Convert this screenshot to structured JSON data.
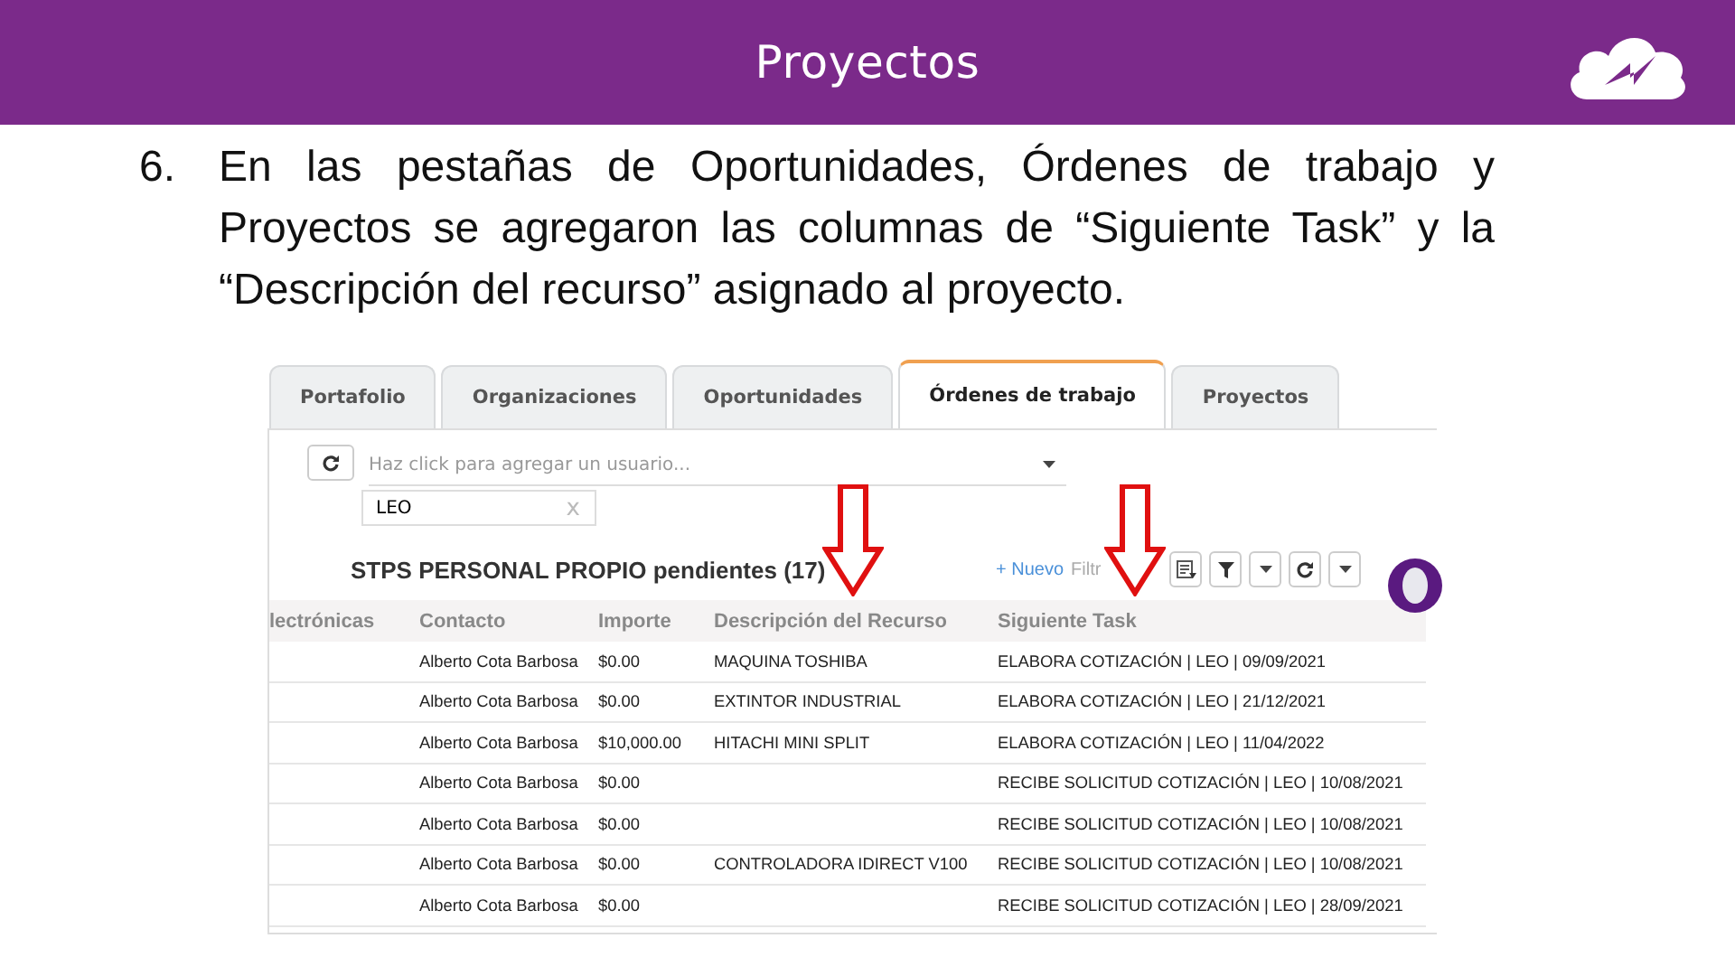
{
  "header": {
    "title": "Proyectos"
  },
  "note": {
    "number": "6.",
    "text": "En las pestañas de Oportunidades, Órdenes de trabajo y Proyectos se agregaron las columnas de “Siguiente Task” y la “Descripción del recurso” asignado al proyecto."
  },
  "app": {
    "tabs": [
      {
        "label": "Portafolio",
        "selected": false
      },
      {
        "label": "Organizaciones",
        "selected": false
      },
      {
        "label": "Oportunidades",
        "selected": false
      },
      {
        "label": "Órdenes de trabajo",
        "selected": true
      },
      {
        "label": "Proyectos",
        "selected": false
      }
    ],
    "user_picker": {
      "placeholder": "Haz click para agregar un usuario...",
      "tags": [
        {
          "label": "LEO",
          "remove": "x"
        }
      ]
    },
    "list_title": "STPS PERSONAL PROPIO pendientes (17)",
    "new_link": "+ Nuevo",
    "filter_link": "Filtr",
    "table": {
      "columns": [
        "lectrónicas",
        "Contacto",
        "Importe",
        "Descripción del Recurso",
        "Siguiente Task"
      ],
      "rows": [
        {
          "contacto": "Alberto Cota Barbosa",
          "importe": "$0.00",
          "descripcion": "MAQUINA TOSHIBA",
          "siguiente": "ELABORA COTIZACIÓN | LEO | 09/09/2021"
        },
        {
          "contacto": "Alberto Cota Barbosa",
          "importe": "$0.00",
          "descripcion": "EXTINTOR INDUSTRIAL",
          "siguiente": "ELABORA COTIZACIÓN | LEO | 21/12/2021"
        },
        {
          "contacto": "Alberto Cota Barbosa",
          "importe": "$10,000.00",
          "descripcion": "HITACHI MINI SPLIT",
          "siguiente": "ELABORA COTIZACIÓN | LEO | 11/04/2022"
        },
        {
          "contacto": "Alberto Cota Barbosa",
          "importe": "$0.00",
          "siguiente": "RECIBE SOLICITUD COTIZACIÓN | LEO | 10/08/2021"
        },
        {
          "contacto": "Alberto Cota Barbosa",
          "importe": "$0.00",
          "siguiente": "RECIBE SOLICITUD COTIZACIÓN | LEO | 10/08/2021"
        },
        {
          "contacto": "Alberto Cota Barbosa",
          "importe": "$0.00",
          "descripcion": "CONTROLADORA IDIRECT V100",
          "siguiente": "RECIBE SOLICITUD COTIZACIÓN | LEO | 10/08/2021"
        },
        {
          "contacto": "Alberto Cota Barbosa",
          "importe": "$0.00",
          "siguiente": "RECIBE SOLICITUD COTIZACIÓN | LEO | 28/09/2021"
        }
      ]
    }
  }
}
